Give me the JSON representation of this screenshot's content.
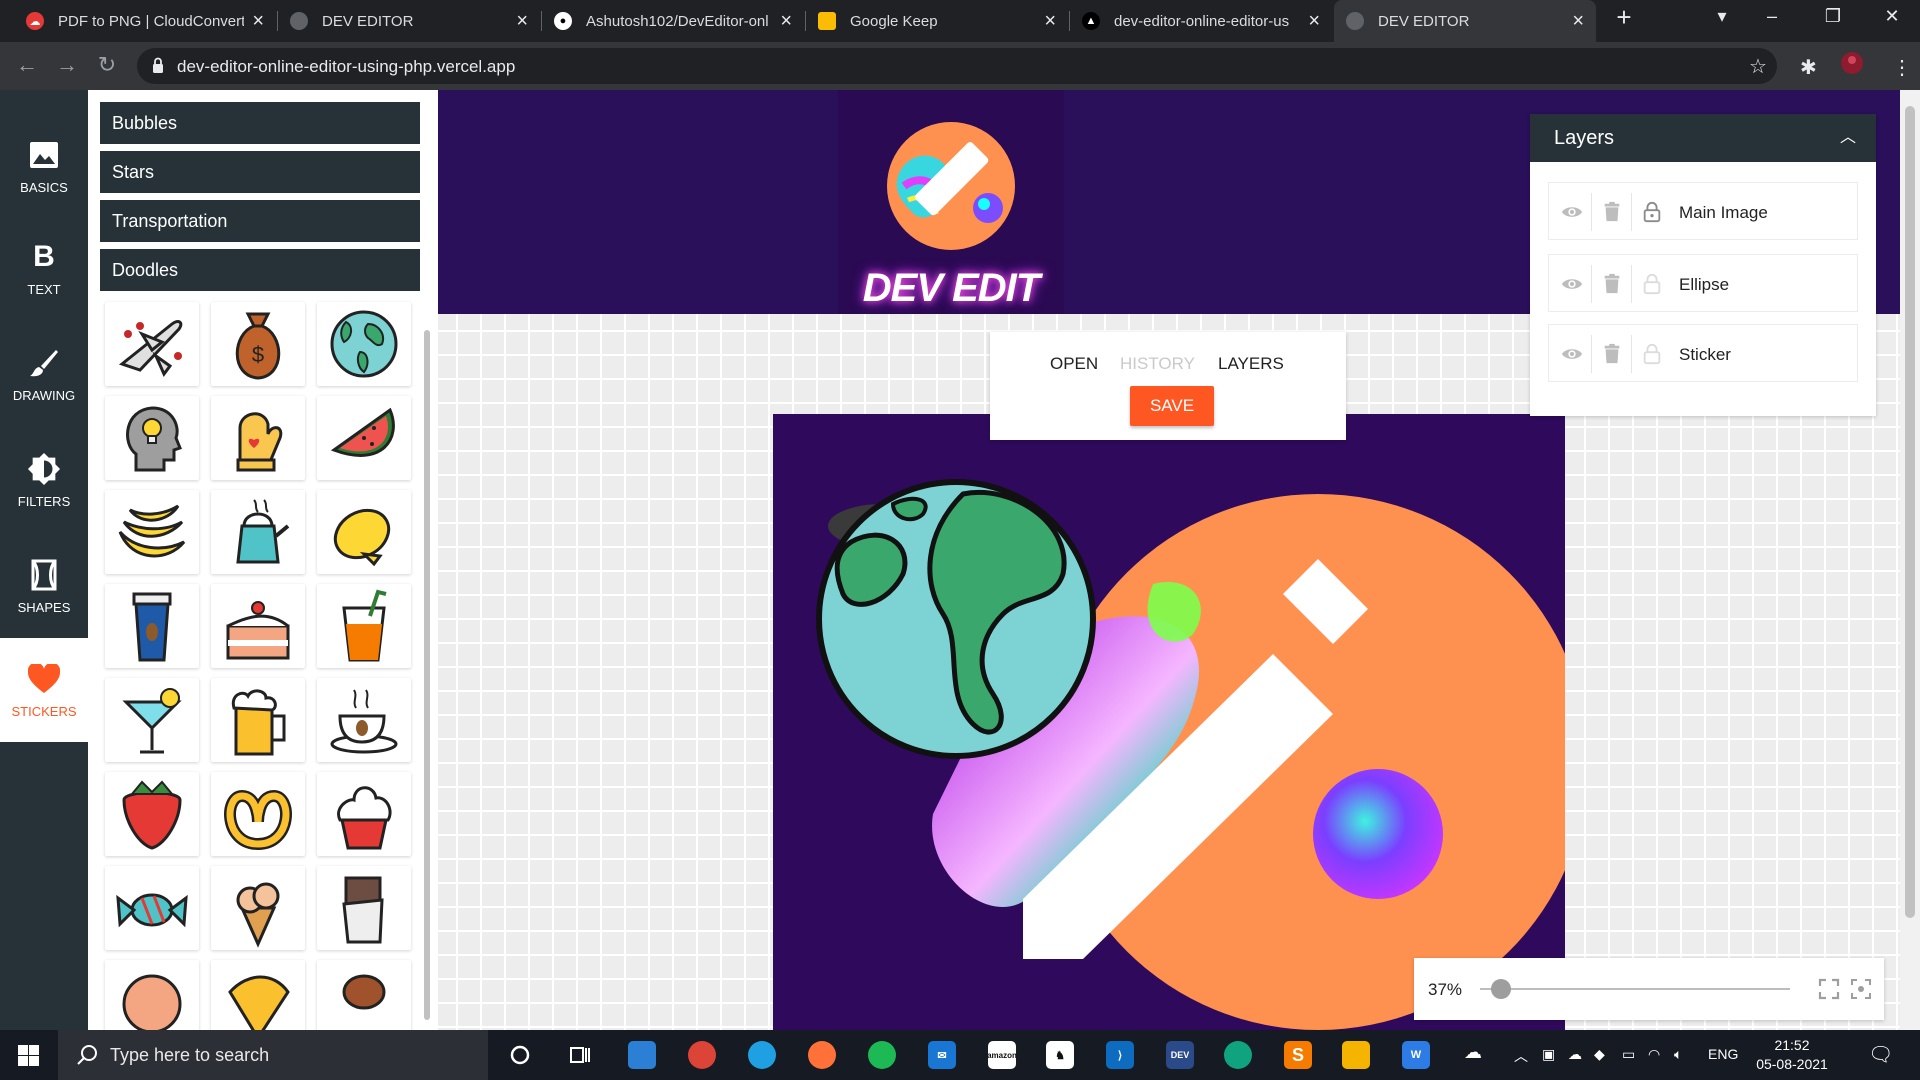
{
  "browser": {
    "tabs": [
      {
        "title": "PDF to PNG | CloudConvert",
        "active": false
      },
      {
        "title": "DEV EDITOR",
        "active": false
      },
      {
        "title": "Ashutosh102/DevEditor-onl",
        "active": false
      },
      {
        "title": "Google Keep",
        "active": false
      },
      {
        "title": "dev-editor-online-editor-us",
        "active": false
      },
      {
        "title": "DEV EDITOR",
        "active": true
      }
    ],
    "url": "dev-editor-online-editor-using-php.vercel.app"
  },
  "nav": {
    "items": [
      {
        "label": "BASICS",
        "icon": "image-icon"
      },
      {
        "label": "TEXT",
        "icon": "bold-icon"
      },
      {
        "label": "DRAWING",
        "icon": "brush-icon"
      },
      {
        "label": "FILTERS",
        "icon": "brightness-icon"
      },
      {
        "label": "SHAPES",
        "icon": "shape-icon"
      },
      {
        "label": "STICKERS",
        "icon": "heart-icon",
        "active": true
      }
    ]
  },
  "stickers": {
    "categories": [
      "Bubbles",
      "Stars",
      "Transportation",
      "Doodles"
    ],
    "items": [
      "airplane",
      "money-bag",
      "globe",
      "idea-head",
      "oven-mitt",
      "watermelon",
      "bananas",
      "kettle",
      "lemon",
      "coffee-cup",
      "cake-slice",
      "juice-glass",
      "cocktail",
      "beer-mug",
      "coffee-saucer",
      "strawberry",
      "pretzel",
      "cupcake",
      "candy",
      "ice-cream",
      "chocolate-bar",
      "donut",
      "pizza-slice",
      "chicken-leg"
    ]
  },
  "logo": {
    "text": "DEV EDIT"
  },
  "actions": {
    "open": "OPEN",
    "history": "HISTORY",
    "layers": "LAYERS",
    "save": "SAVE"
  },
  "layers": {
    "title": "Layers",
    "items": [
      {
        "name": "Main Image",
        "locked": true
      },
      {
        "name": "Ellipse",
        "locked": false
      },
      {
        "name": "Sticker",
        "locked": false
      }
    ]
  },
  "zoom": {
    "label": "37%",
    "value_percent": 37
  },
  "taskbar": {
    "search_placeholder": "Type here to search",
    "language": "ENG",
    "time": "21:52",
    "date": "05-08-2021"
  },
  "colors": {
    "accent": "#ff5722",
    "nav": "#263238",
    "header": "#2a0f5a",
    "canvas": "#2f0a5c"
  }
}
